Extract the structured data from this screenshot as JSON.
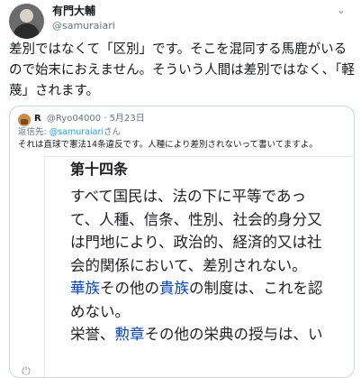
{
  "user": {
    "name": "有門大輔",
    "handle": "@samuraiari"
  },
  "tweet": {
    "text": "差別ではなくて「区別」です。そこを混同する馬鹿がいるので始末におえません。そういう人間は差別ではなく、「軽蔑」されます。"
  },
  "quoted": {
    "name": "R",
    "handle": "@Ryo04000",
    "date": "· 5月23日",
    "reply_prefix": "返信先: ",
    "reply_link": "@samuraiari",
    "reply_suffix": "さん",
    "text": "それは直球で憲法14条違反です。人種により差別されないって書いてますよ。",
    "document": {
      "title": "第十四条",
      "lines": [
        [
          {
            "t": "すべて国民は、法の下に平等であっ"
          }
        ],
        [
          {
            "t": "て、人種、信条、性別、社会的身分又"
          }
        ],
        [
          {
            "t": "は門地により、政治的、経済的又は社"
          }
        ],
        [
          {
            "t": "会的関係において、差別されない。"
          }
        ],
        [
          {
            "t": "華族",
            "link": true
          },
          {
            "t": "その他の"
          },
          {
            "t": "貴族",
            "link": true
          },
          {
            "t": "の制度は、これを認"
          }
        ],
        [
          {
            "t": "めない。"
          }
        ],
        [
          {
            "t": "栄誉、"
          },
          {
            "t": "勲章",
            "link": true
          },
          {
            "t": "その他の栄典の授与は、い"
          }
        ]
      ]
    }
  },
  "icons": {
    "more": "chevron-down-icon",
    "power": "power-icon"
  },
  "colors": {
    "link": "#0645ad",
    "mention": "#1da1f2",
    "secondary_text": "#657786"
  }
}
